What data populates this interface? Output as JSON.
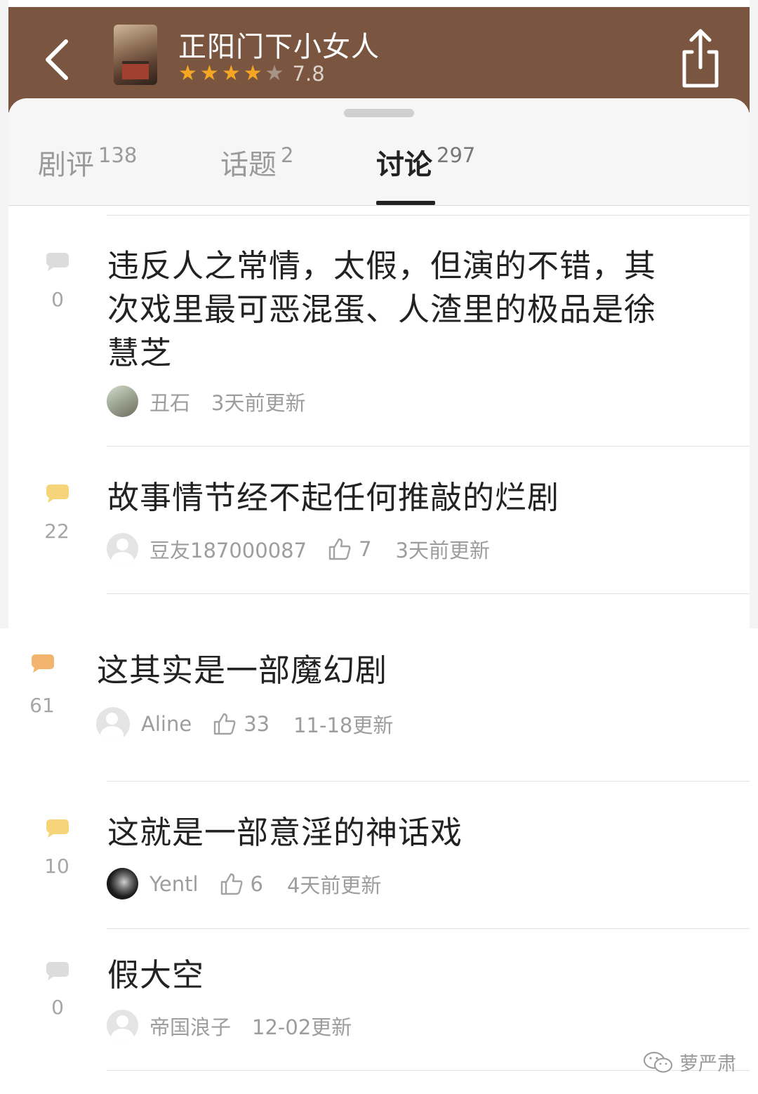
{
  "header": {
    "back_icon": "chevron-left-icon",
    "title": "正阳门下小女人",
    "stars": 4,
    "stars_max": 5,
    "rating": "7.8",
    "share_icon": "share-icon",
    "bg_color": "#7a5640"
  },
  "tabs": [
    {
      "label": "剧评",
      "count": "138",
      "active": false
    },
    {
      "label": "话题",
      "count": "2",
      "active": false
    },
    {
      "label": "讨论",
      "count": "297",
      "active": true
    }
  ],
  "items": [
    {
      "comments": "0",
      "bubble_color": "#dcdcdc",
      "title_lines": [
        "违反人之常情，太假，但演的不错，其",
        "次戏里最可恶混蛋、人渣里的极品是徐",
        "慧芝"
      ],
      "author": "丑石",
      "likes": "",
      "time": "3天前更新",
      "avatar": "photo"
    },
    {
      "comments": "22",
      "bubble_color": "#f6d479",
      "title_lines": [
        "故事情节经不起任何推敲的烂剧"
      ],
      "author": "豆友187000087",
      "likes": "7",
      "time": "3天前更新",
      "avatar": "default"
    },
    {
      "comments": "61",
      "bubble_color": "#f3b56d",
      "title_lines": [
        "这其实是一部魔幻剧"
      ],
      "author": "Aline",
      "likes": "33",
      "time": "11-18更新",
      "avatar": "default"
    },
    {
      "comments": "10",
      "bubble_color": "#f6d479",
      "title_lines": [
        "这就是一部意淫的神话戏"
      ],
      "author": "Yentl",
      "likes": "6",
      "time": "4天前更新",
      "avatar": "dark"
    },
    {
      "comments": "0",
      "bubble_color": "#dcdcdc",
      "title_lines": [
        "假大空"
      ],
      "author": "帝国浪子",
      "likes": "",
      "time": "12-02更新",
      "avatar": "default"
    }
  ],
  "watermark": {
    "icon": "wechat-icon",
    "text": "萝严肃"
  }
}
